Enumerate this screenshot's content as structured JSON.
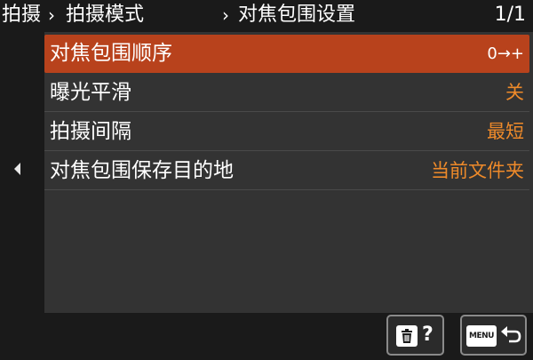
{
  "header": {
    "crumb_1": "拍摄",
    "sep_1": "›",
    "crumb_2": "拍摄模式",
    "sep_2": "›",
    "crumb_3": "对焦包围设置",
    "page_indicator": "1/1"
  },
  "menu": {
    "items": [
      {
        "label": "对焦包围顺序",
        "value": "0→+",
        "selected": true
      },
      {
        "label": "曝光平滑",
        "value": "关",
        "selected": false
      },
      {
        "label": "拍摄间隔",
        "value": "最短",
        "selected": false
      },
      {
        "label": "对焦包围保存目的地",
        "value": "当前文件夹",
        "selected": false
      }
    ]
  },
  "footer": {
    "help_glyph": "?",
    "menu_button_text": "MENU"
  },
  "colors": {
    "selected_row": "#b8421c",
    "value_text": "#ee8a2a",
    "panel": "#333333",
    "background": "#1a1a1a"
  },
  "icons": {
    "page_left": "left-arrow-icon",
    "delete": "trash-icon",
    "help": "question-icon",
    "menu": "menu-icon",
    "back": "return-icon"
  }
}
